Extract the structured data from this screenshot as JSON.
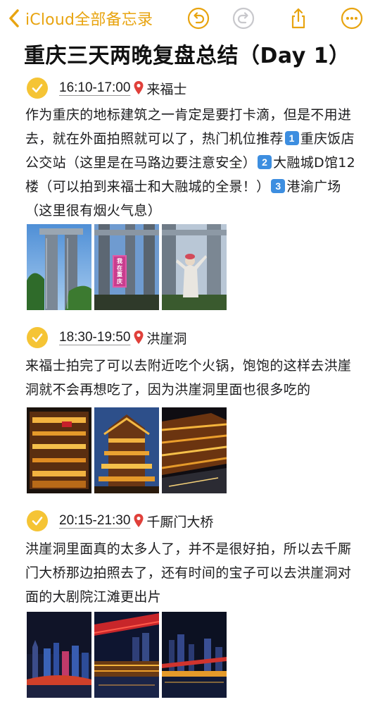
{
  "nav": {
    "back_label": "iCloud全部备忘录",
    "accent_color": "#E8A410",
    "icons": [
      "chevron-left-icon",
      "undo-icon",
      "redo-icon",
      "share-icon",
      "more-icon"
    ]
  },
  "note": {
    "title": "重庆三天两晚复盘总结（Day 1）",
    "sections": [
      {
        "time": "16:10-17:00",
        "place": "来福士",
        "text_parts": {
          "p1": "作为重庆的地标建筑之一肯定是要打卡滴，但是不用进去，就在外面拍照就可以了，热门机位推荐",
          "n1": "1",
          "p2": "重庆饭店公交站（这里是在马路边要注意安全）",
          "n2": "2",
          "p3": "大融城D馆12楼（可以拍到来福士和大融城的全景！）",
          "n3": "3",
          "p4": "港渝广场（这里很有烟火气息）"
        },
        "photo_sign_text": "我在重庆",
        "photos": [
          "raffles-tower-photo",
          "raffles-sign-photo",
          "raffles-person-photo"
        ]
      },
      {
        "time": "18:30-19:50",
        "place": "洪崖洞",
        "text": "来福士拍完了可以去附近吃个火锅，饱饱的这样去洪崖洞就不会再想吃了，因为洪崖洞里面也很多吃的",
        "photos": [
          "hongyadong-night-photo-1",
          "hongyadong-night-photo-2",
          "hongyadong-night-photo-3"
        ]
      },
      {
        "time": "20:15-21:30",
        "place": "千厮门大桥",
        "text": "洪崖洞里面真的太多人了，并不是很好拍，所以去千厮门大桥那边拍照去了，还有时间的宝子可以去洪崖洞对面的大剧院江滩更出片",
        "photos": [
          "qiansimen-bridge-photo-1",
          "qiansimen-bridge-photo-2",
          "qiansimen-bridge-photo-3"
        ]
      }
    ]
  },
  "colors": {
    "check_yellow": "#F5C435",
    "number_badge_blue": "#3D8EE0",
    "pin_red": "#E0403A"
  }
}
